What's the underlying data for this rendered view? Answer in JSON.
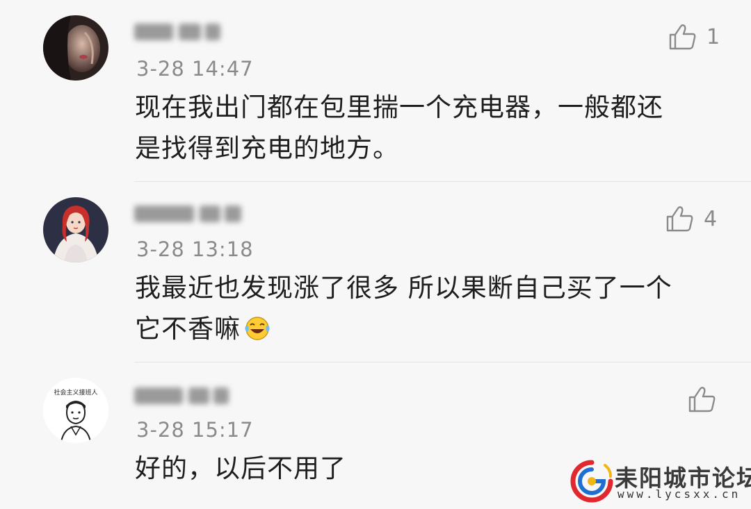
{
  "comments": [
    {
      "username": "████ ██",
      "timestamp": "3-28 14:47",
      "text_line1": "现在我出门都在包里揣一个充电器，一般都还",
      "text_line2": "是找得到充电的地方。",
      "like_count": "1",
      "avatar": "avatar-woman-dark"
    },
    {
      "username": "███████",
      "timestamp": "3-28 13:18",
      "text_line1": "我最近也发现涨了很多 所以果断自己买了一个",
      "text_line2": "它不香嘛",
      "like_count": "4",
      "avatar": "avatar-cartoon-princess",
      "emoji": "laughing-crying-emoji"
    },
    {
      "username": "██████",
      "timestamp": "3-28 15:17",
      "text_line1": "好的，以后不用了",
      "like_count": "",
      "avatar": "avatar-sketch-portrait",
      "avatar_caption": "社会主义接班人"
    }
  ],
  "icons": {
    "like": "thumbs-up-icon"
  },
  "watermark": {
    "title": "耒阳城市论坛",
    "url": "www.lycsxx.cn"
  },
  "colors": {
    "background": "#f7f7f7",
    "text": "#1e1e1e",
    "meta": "#8a8a8a",
    "logo_red": "#e0282e",
    "logo_blue": "#1f6fd1",
    "logo_yellow": "#f2b618"
  }
}
